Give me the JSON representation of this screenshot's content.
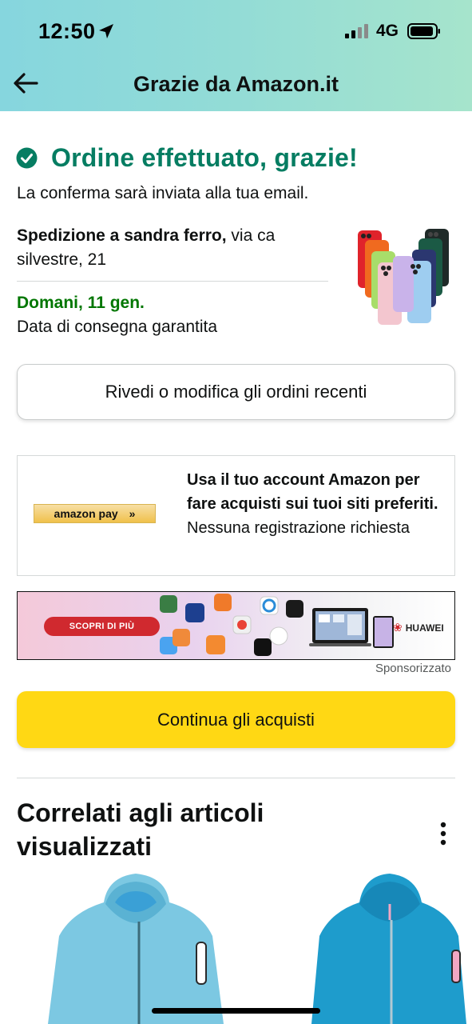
{
  "status_bar": {
    "time": "12:50",
    "network": "4G"
  },
  "nav": {
    "title": "Grazie da Amazon.it"
  },
  "confirmation": {
    "title": "Ordine effettuato, grazie!",
    "subtitle": "La conferma sarà inviata alla tua email.",
    "shipping_bold": "Spedizione a sandra ferro,",
    "shipping_address": " via ca silvestre, 21",
    "delivery_date": "Domani, 11 gen.",
    "delivery_label": "Data di consegna garantita"
  },
  "review_button": {
    "label": "Rivedi o modifica gli ordini recenti"
  },
  "amazon_pay": {
    "logo_text": "amazon pay",
    "headline": "Usa il tuo account Amazon per fare acquisti sui tuoi siti preferiti.",
    "subtext": "Nessuna registrazione richiesta"
  },
  "ad": {
    "cta": "SCOPRI DI PIÙ",
    "brand": "HUAWEI",
    "sponsored_label": "Sponsorizzato"
  },
  "continue_button": {
    "label": "Continua gli acquisti"
  },
  "related": {
    "title": "Correlati agli articoli visualizzati"
  },
  "colors": {
    "success_green": "#067d62",
    "delivery_green": "#007600",
    "primary_button_yellow": "#ffd814",
    "header_gradient_start": "#86d6de",
    "header_gradient_end": "#a6e4cc"
  },
  "icons": {
    "back": "arrow-left-icon",
    "check": "check-circle-icon",
    "more": "vertical-dots-icon",
    "location": "location-arrow-icon",
    "signal": "cellular-signal-icon",
    "battery": "battery-icon"
  }
}
